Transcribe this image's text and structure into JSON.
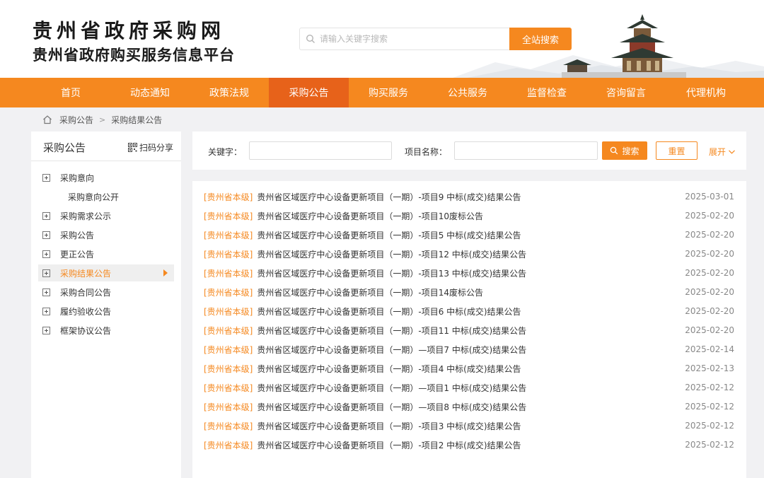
{
  "header": {
    "title_main": "贵州省政府采购网",
    "title_sub": "贵州省政府购买服务信息平台",
    "search_placeholder": "请输入关键字搜索",
    "search_button": "全站搜索"
  },
  "nav": {
    "items": [
      {
        "label": "首页"
      },
      {
        "label": "动态通知"
      },
      {
        "label": "政策法规"
      },
      {
        "label": "采购公告"
      },
      {
        "label": "购买服务"
      },
      {
        "label": "公共服务"
      },
      {
        "label": "监督检查"
      },
      {
        "label": "咨询留言"
      },
      {
        "label": "代理机构"
      }
    ],
    "active": "采购公告"
  },
  "breadcrumb": {
    "items": [
      "采购公告",
      "采购结果公告"
    ]
  },
  "sidebar": {
    "title": "采购公告",
    "share_label": "扫码分享",
    "items": [
      {
        "label": "采购意向"
      },
      {
        "label": "采购意向公开"
      },
      {
        "label": "采购需求公示"
      },
      {
        "label": "采购公告"
      },
      {
        "label": "更正公告"
      },
      {
        "label": "采购结果公告"
      },
      {
        "label": "采购合同公告"
      },
      {
        "label": "履约验收公告"
      },
      {
        "label": "框架协议公告"
      }
    ],
    "active": "采购结果公告"
  },
  "filter": {
    "keyword_label": "关键字：",
    "keyword_value": "",
    "project_label": "项目名称：",
    "project_value": "",
    "search_label": "搜索",
    "reset_label": "重置",
    "expand_label": "展开"
  },
  "results": [
    {
      "tag": "[贵州省本级]",
      "title": "贵州省区域医疗中心设备更新项目（一期）-项目9 中标(成交)结果公告",
      "date": "2025-03-01"
    },
    {
      "tag": "[贵州省本级]",
      "title": "贵州省区域医疗中心设备更新项目（一期）-项目10废标公告",
      "date": "2025-02-20"
    },
    {
      "tag": "[贵州省本级]",
      "title": "贵州省区域医疗中心设备更新项目（一期）-项目5 中标(成交)结果公告",
      "date": "2025-02-20"
    },
    {
      "tag": "[贵州省本级]",
      "title": "贵州省区域医疗中心设备更新项目（一期）-项目12 中标(成交)结果公告",
      "date": "2025-02-20"
    },
    {
      "tag": "[贵州省本级]",
      "title": "贵州省区域医疗中心设备更新项目（一期）-项目13 中标(成交)结果公告",
      "date": "2025-02-20"
    },
    {
      "tag": "[贵州省本级]",
      "title": "贵州省区域医疗中心设备更新项目（一期）-项目14废标公告",
      "date": "2025-02-20"
    },
    {
      "tag": "[贵州省本级]",
      "title": "贵州省区域医疗中心设备更新项目（一期）-项目6 中标(成交)结果公告",
      "date": "2025-02-20"
    },
    {
      "tag": "[贵州省本级]",
      "title": "贵州省区域医疗中心设备更新项目（一期）-项目11 中标(成交)结果公告",
      "date": "2025-02-20"
    },
    {
      "tag": "[贵州省本级]",
      "title": "贵州省区域医疗中心设备更新项目（一期）—项目7 中标(成交)结果公告",
      "date": "2025-02-14"
    },
    {
      "tag": "[贵州省本级]",
      "title": "贵州省区域医疗中心设备更新项目（一期）-项目4 中标(成交)结果公告",
      "date": "2025-02-13"
    },
    {
      "tag": "[贵州省本级]",
      "title": "贵州省区域医疗中心设备更新项目（一期）—项目1 中标(成交)结果公告",
      "date": "2025-02-12"
    },
    {
      "tag": "[贵州省本级]",
      "title": "贵州省区域医疗中心设备更新项目（一期）—项目8 中标(成交)结果公告",
      "date": "2025-02-12"
    },
    {
      "tag": "[贵州省本级]",
      "title": "贵州省区域医疗中心设备更新项目（一期）-项目3 中标(成交)结果公告",
      "date": "2025-02-12"
    },
    {
      "tag": "[贵州省本级]",
      "title": "贵州省区域医疗中心设备更新项目（一期）-项目2 中标(成交)结果公告",
      "date": "2025-02-12"
    }
  ],
  "colors": {
    "accent": "#f5881f",
    "nav_active": "#e7621a"
  },
  "icons": [
    "search-icon",
    "home-icon",
    "qr-code-icon",
    "chevron-down-icon",
    "plus-box-icon",
    "caret-right-icon",
    "pagoda-illustration"
  ]
}
